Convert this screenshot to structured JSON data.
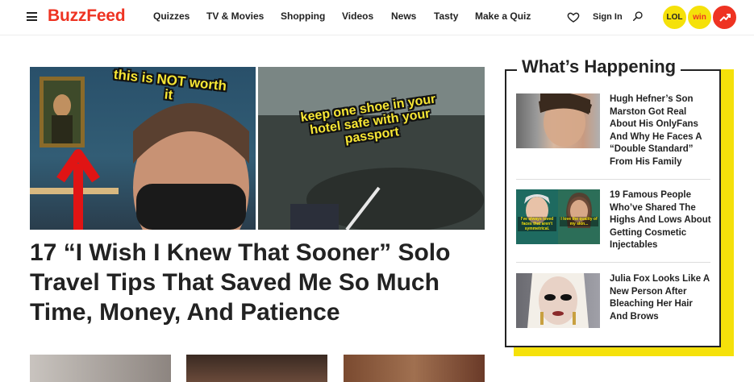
{
  "header": {
    "logo": "BuzzFeed",
    "nav": [
      "Quizzes",
      "TV & Movies",
      "Shopping",
      "Videos",
      "News",
      "Tasty",
      "Make a Quiz"
    ],
    "sign_in": "Sign In",
    "badges": {
      "lol": "LOL",
      "win": "win"
    }
  },
  "hero": {
    "left_caption": "this is NOT worth it",
    "right_caption": "keep one shoe in your hotel safe with your passport",
    "title": "17 “I Wish I Knew That Sooner” Solo Travel Tips That Saved Me So Much Time, Money, And Patience"
  },
  "whats_happening": {
    "heading": "What’s Happening",
    "items": [
      {
        "title": "Hugh Hefner’s Son Marston Got Real About His OnlyFans And Why He Faces A “Double Standard” From His Family"
      },
      {
        "title": "19 Famous People Who’ve Shared The Highs And Lows About Getting Cosmetic Injectables",
        "captions": [
          "I've always loved faces that aren't symmetrical.",
          "I love the quality of my skin..."
        ]
      },
      {
        "title": "Julia Fox Looks Like A New Person After Bleaching Her Hair And Brows"
      }
    ]
  },
  "colors": {
    "brand_red": "#ee3322",
    "accent_yellow": "#f5e10a",
    "text": "#222222"
  }
}
